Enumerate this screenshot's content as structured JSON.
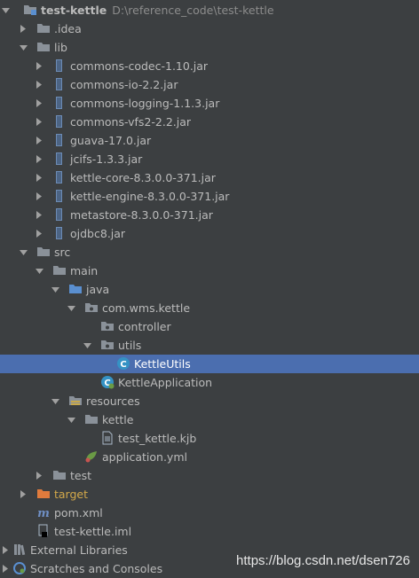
{
  "project": {
    "name": "test-kettle",
    "path": "D:\\reference_code\\test-kettle"
  },
  "items": [
    {
      "label": "test-kettle",
      "level": 0,
      "arrow": "down",
      "icon": "module-folder-icon"
    },
    {
      "label": ".idea",
      "level": 1,
      "arrow": "right",
      "icon": "folder-icon"
    },
    {
      "label": "lib",
      "level": 1,
      "arrow": "down",
      "icon": "folder-icon"
    },
    {
      "label": "commons-codec-1.10.jar",
      "level": 2,
      "arrow": "right",
      "icon": "jar-icon"
    },
    {
      "label": "commons-io-2.2.jar",
      "level": 2,
      "arrow": "right",
      "icon": "jar-icon"
    },
    {
      "label": "commons-logging-1.1.3.jar",
      "level": 2,
      "arrow": "right",
      "icon": "jar-icon"
    },
    {
      "label": "commons-vfs2-2.2.jar",
      "level": 2,
      "arrow": "right",
      "icon": "jar-icon"
    },
    {
      "label": "guava-17.0.jar",
      "level": 2,
      "arrow": "right",
      "icon": "jar-icon"
    },
    {
      "label": "jcifs-1.3.3.jar",
      "level": 2,
      "arrow": "right",
      "icon": "jar-icon"
    },
    {
      "label": "kettle-core-8.3.0.0-371.jar",
      "level": 2,
      "arrow": "right",
      "icon": "jar-icon"
    },
    {
      "label": "kettle-engine-8.3.0.0-371.jar",
      "level": 2,
      "arrow": "right",
      "icon": "jar-icon"
    },
    {
      "label": "metastore-8.3.0.0-371.jar",
      "level": 2,
      "arrow": "right",
      "icon": "jar-icon"
    },
    {
      "label": "ojdbc8.jar",
      "level": 2,
      "arrow": "right",
      "icon": "jar-icon"
    },
    {
      "label": "src",
      "level": 1,
      "arrow": "down",
      "icon": "folder-icon"
    },
    {
      "label": "main",
      "level": 2,
      "arrow": "down",
      "icon": "folder-icon"
    },
    {
      "label": "java",
      "level": 3,
      "arrow": "down",
      "icon": "source-folder-icon"
    },
    {
      "label": "com.wms.kettle",
      "level": 4,
      "arrow": "down",
      "icon": "package-icon"
    },
    {
      "label": "controller",
      "level": 5,
      "arrow": "none",
      "icon": "package-icon"
    },
    {
      "label": "utils",
      "level": 5,
      "arrow": "down",
      "icon": "package-icon"
    },
    {
      "label": "KettleUtils",
      "level": 6,
      "arrow": "none",
      "icon": "java-class-icon"
    },
    {
      "label": "KettleApplication",
      "level": 5,
      "arrow": "none",
      "icon": "spring-app-class-icon"
    },
    {
      "label": "resources",
      "level": 3,
      "arrow": "down",
      "icon": "resources-folder-icon"
    },
    {
      "label": "kettle",
      "level": 4,
      "arrow": "down",
      "icon": "folder-icon"
    },
    {
      "label": "test_kettle.kjb",
      "level": 5,
      "arrow": "none",
      "icon": "text-file-icon"
    },
    {
      "label": "application.yml",
      "level": 4,
      "arrow": "none",
      "icon": "spring-config-icon"
    },
    {
      "label": "test",
      "level": 2,
      "arrow": "right",
      "icon": "folder-icon"
    },
    {
      "label": "target",
      "level": 1,
      "arrow": "right",
      "icon": "excluded-folder-icon"
    },
    {
      "label": "pom.xml",
      "level": 1,
      "arrow": "none",
      "icon": "maven-icon"
    },
    {
      "label": "test-kettle.iml",
      "level": 1,
      "arrow": "none",
      "icon": "iml-file-icon"
    },
    {
      "label": "External Libraries",
      "level": 0,
      "arrow": "right",
      "icon": "library-icon"
    },
    {
      "label": "Scratches and Consoles",
      "level": 0,
      "arrow": "right",
      "icon": "scratches-icon"
    }
  ],
  "selected": "KettleUtils",
  "colors": {
    "background": "#3c3f41",
    "selection": "#4b6eaf",
    "text": "#bbbbbb",
    "folder": "#8a9199",
    "excluded": "#e07b3d",
    "source": "#5a8fd0",
    "resources": "#c9a94b",
    "jar": "#6c8bb4",
    "class": "#3592c4"
  },
  "watermark": "https://blog.csdn.net/dsen726"
}
